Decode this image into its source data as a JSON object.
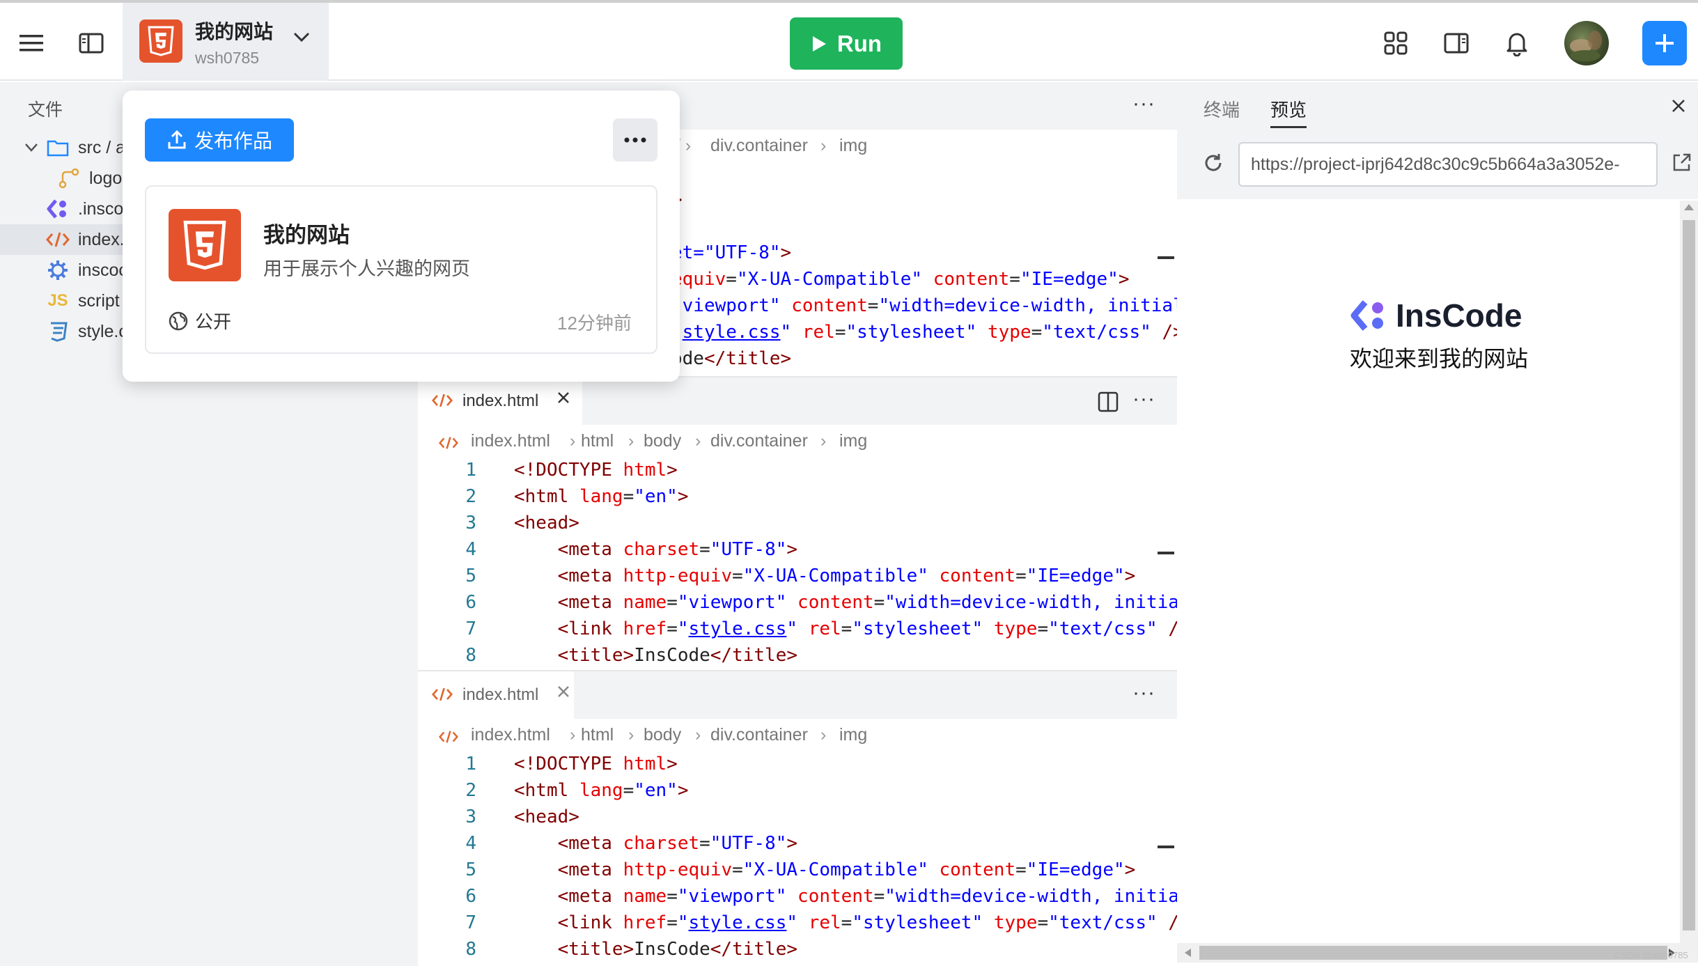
{
  "header": {
    "project_name": "我的网站",
    "username": "wsh0785",
    "run_label": "Run"
  },
  "sidebar": {
    "title": "文件",
    "items": [
      {
        "label": "src / a",
        "icon": "folder-icon"
      },
      {
        "label": "logo",
        "icon": "git-branch-icon"
      },
      {
        "label": ".insco",
        "icon": "inscode-icon"
      },
      {
        "label": "index.",
        "icon": "html-code-icon"
      },
      {
        "label": "inscoc",
        "icon": "gear-icon"
      },
      {
        "label": "script",
        "icon": "js-icon"
      },
      {
        "label": "style.c",
        "icon": "css-icon"
      }
    ]
  },
  "popover": {
    "publish_label": "发布作品",
    "card_title": "我的网站",
    "card_desc": "用于展示个人兴趣的网页",
    "visibility": "公开",
    "time": "12分钟前"
  },
  "editor": {
    "tab_label": "index.html",
    "breadcrumb": [
      "index.html",
      "html",
      "body",
      "div.container",
      "img"
    ],
    "top_crumb": [
      "div.container",
      "img"
    ]
  },
  "right_panel": {
    "tabs": [
      "终端",
      "预览"
    ],
    "url": "https://project-iprj642d8c30c9c5b664a3a3052e-",
    "brand": "InsCode",
    "welcome": "欢迎来到我的网站"
  },
  "watermark": "CSDN @wsh0785"
}
